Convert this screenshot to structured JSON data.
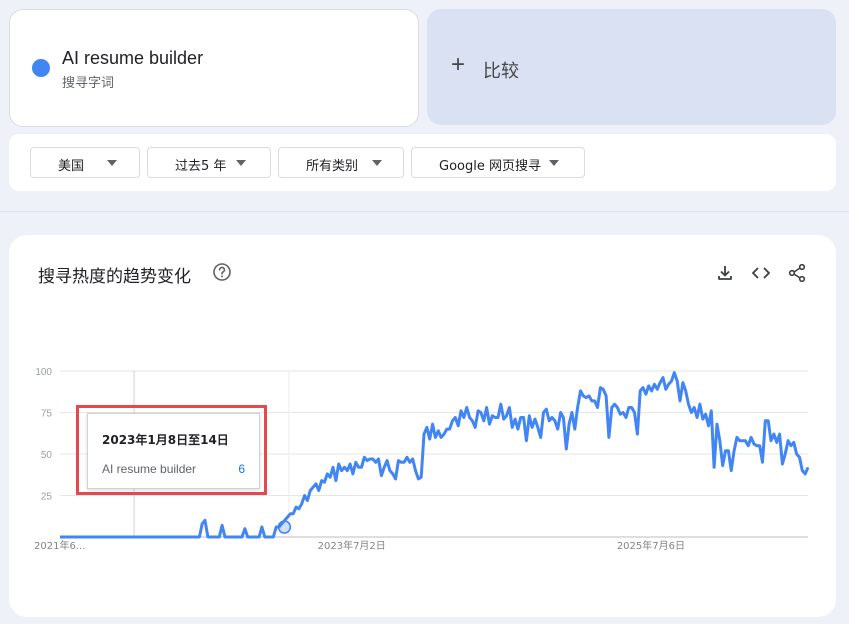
{
  "search_term": {
    "name": "AI resume builder",
    "subtitle": "搜寻字词",
    "color": "#4285f4"
  },
  "compare": {
    "plus": "+",
    "label": "比较"
  },
  "filters": {
    "region": "美国",
    "time_range": "过去5 年",
    "category": "所有类别",
    "search_type": "Google 网页搜寻"
  },
  "chart": {
    "title": "搜寻热度的趋势变化",
    "icons": [
      "help-icon",
      "download-icon",
      "embed-icon",
      "share-icon"
    ],
    "tooltip": {
      "date": "2023年1月8日至14日",
      "term": "AI resume builder",
      "value": "6"
    }
  },
  "chart_data": {
    "type": "line",
    "ylim": [
      0,
      100
    ],
    "y_ticks": [
      "25",
      "50",
      "75",
      "100"
    ],
    "x_ticks": [
      {
        "label": "2021年6...",
        "t": 0
      },
      {
        "label": "2023年7月2日",
        "t": 0.39
      },
      {
        "label": "2025年7月6日",
        "t": 0.79
      }
    ],
    "highlight_t": 0.3,
    "series": [
      {
        "name": "AI resume builder",
        "color": "#4285f4",
        "values": [
          0,
          0,
          0,
          0,
          0,
          0,
          0,
          0,
          0,
          0,
          0,
          0,
          0,
          0,
          0,
          0,
          0,
          0,
          0,
          0,
          0,
          0,
          0,
          0,
          0,
          0,
          0,
          0,
          0,
          0,
          0,
          0,
          0,
          0,
          0,
          0,
          0,
          0,
          0,
          0,
          0,
          0,
          0,
          0,
          0,
          0,
          0,
          0,
          0,
          0,
          8,
          10,
          0,
          0,
          0,
          0,
          0,
          7,
          0,
          0,
          0,
          0,
          0,
          0,
          0,
          5,
          0,
          0,
          0,
          0,
          0,
          6,
          0,
          0,
          0,
          0,
          6,
          6,
          8,
          10,
          12,
          14,
          14,
          18,
          17,
          20,
          25,
          22,
          28,
          30,
          32,
          28,
          34,
          33,
          38,
          36,
          42,
          34,
          44,
          40,
          42,
          40,
          44,
          38,
          45,
          42,
          42,
          48,
          46,
          47,
          47,
          45,
          47,
          37,
          42,
          46,
          40,
          38,
          35,
          46,
          45,
          45,
          48,
          45,
          47,
          40,
          35,
          36,
          62,
          66,
          59,
          68,
          60,
          64,
          60,
          62,
          65,
          65,
          70,
          72,
          67,
          76,
          72,
          78,
          72,
          70,
          66,
          76,
          75,
          70,
          78,
          68,
          73,
          72,
          72,
          80,
          71,
          73,
          78,
          66,
          71,
          65,
          72,
          72,
          58,
          73,
          66,
          71,
          66,
          60,
          75,
          77,
          70,
          72,
          70,
          65,
          75,
          72,
          53,
          68,
          75,
          65,
          78,
          88,
          85,
          84,
          85,
          82,
          82,
          78,
          90,
          89,
          85,
          60,
          78,
          80,
          78,
          74,
          75,
          72,
          78,
          78,
          75,
          62,
          88,
          90,
          86,
          91,
          88,
          92,
          89,
          93,
          96,
          89,
          92,
          94,
          99,
          94,
          82,
          93,
          88,
          80,
          75,
          78,
          72,
          80,
          71,
          74,
          67,
          76,
          42,
          68,
          58,
          43,
          52,
          52,
          40,
          52,
          60,
          58,
          58,
          58,
          55,
          60,
          56,
          55,
          55,
          45,
          70,
          70,
          58,
          62,
          57,
          62,
          44,
          50,
          58,
          55,
          57,
          50,
          48,
          40,
          38,
          42
        ]
      }
    ]
  }
}
